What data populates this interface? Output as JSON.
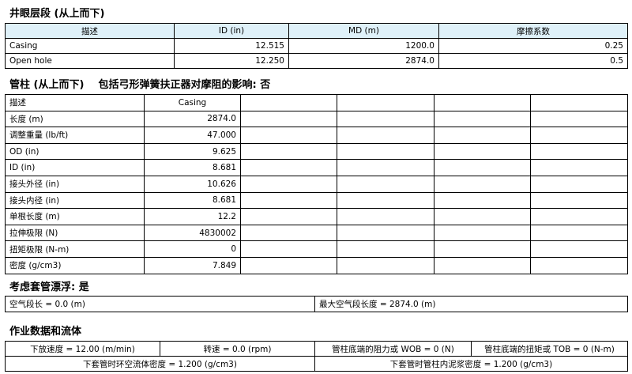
{
  "wellbore": {
    "title": "井眼层段 (从上而下)",
    "headers": [
      "描述",
      "ID (in)",
      "MD (m)",
      "摩擦系数"
    ],
    "rows": [
      [
        "Casing",
        "12.515",
        "1200.0",
        "0.25"
      ],
      [
        "Open hole",
        "12.250",
        "2874.0",
        "0.5"
      ]
    ]
  },
  "string": {
    "title": "管柱 (从上而下)    包括弓形弹簧扶正器对摩阻的影响: 否",
    "rows": [
      [
        "描述",
        "Casing"
      ],
      [
        "长度 (m)",
        "2874.0"
      ],
      [
        "调整重量 (lb/ft)",
        "47.000"
      ],
      [
        "OD (in)",
        "9.625"
      ],
      [
        "ID (in)",
        "8.681"
      ],
      [
        "接头外径 (in)",
        "10.626"
      ],
      [
        "接头内径 (in)",
        "8.681"
      ],
      [
        "单根长度 (m)",
        "12.2"
      ],
      [
        "拉伸极限 (N)",
        "4830002"
      ],
      [
        "扭矩极限 (N-m)",
        "0"
      ],
      [
        "密度 (g/cm3)",
        "7.849"
      ]
    ]
  },
  "floatation": {
    "title": "考虑套管漂浮: 是",
    "air_length": "空气段长 = 0.0 (m)",
    "max_air_length": "最大空气段长度 = 2874.0 (m)"
  },
  "operations": {
    "title": "作业数据和流体",
    "row1": [
      "下放速度 = 12.00 (m/min)",
      "转速 = 0.0 (rpm)",
      "管柱底端的阻力或 WOB = 0 (N)",
      "管柱底端的扭矩或 TOB = 0 (N-m)"
    ],
    "row2": [
      "下套管时环空流体密度 = 1.200 (g/cm3)",
      "下套管时管柱内泥浆密度 = 1.200 (g/cm3)"
    ]
  }
}
